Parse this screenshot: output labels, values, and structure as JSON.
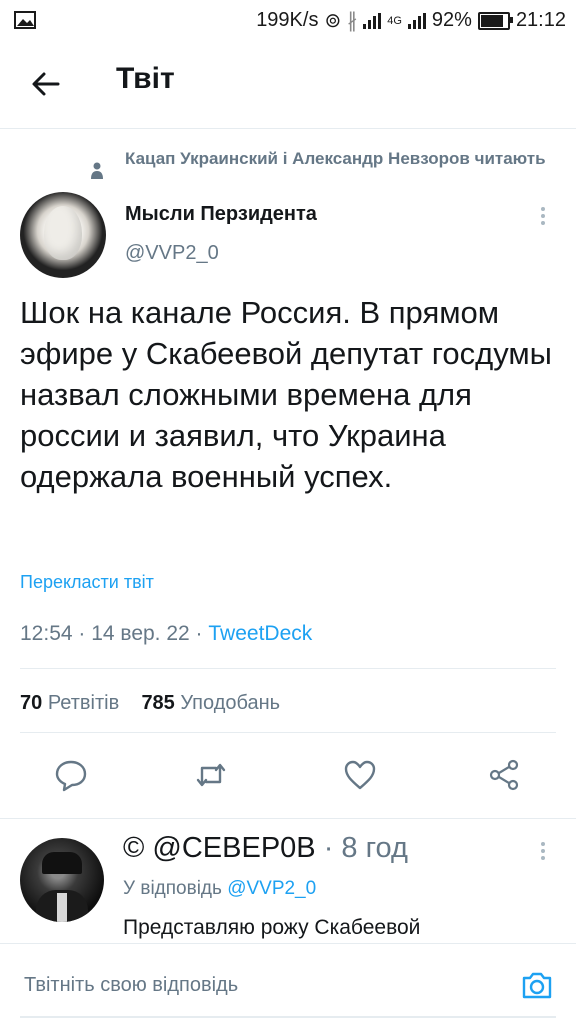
{
  "status_bar": {
    "speed": "199K/s",
    "network": "4G",
    "battery": "92%",
    "battery_level": 0.92,
    "time": "21:12"
  },
  "header": {
    "title": "Твіт"
  },
  "tweet": {
    "social_context": "Кацап Украинский і Александр Невзоров читають",
    "author_name": "Мысли Перзидента",
    "author_handle": "@VVP2_0",
    "text": "Шок на канале Россия. В прямом эфире у Скабеевой депутат госдумы назвал сложными времена для россии и заявил, что Украина одержала военный успех.",
    "translate_label": "Перекласти твіт",
    "timestamp": "12:54 · 14 вер. 22 · ",
    "source": "TweetDeck",
    "retweets_count": "70",
    "retweets_label": "Ретвітів",
    "likes_count": "785",
    "likes_label": "Уподобань"
  },
  "reply": {
    "author": "© @СЕВЕР0В",
    "time": " · 8 год",
    "reply_prefix": "У відповідь ",
    "reply_to": "@VVP2_0",
    "text": "Представляю рожу Скабеевой"
  },
  "compose": {
    "placeholder": "Твітніть свою відповідь"
  },
  "colors": {
    "accent": "#1da1f2",
    "secondary_text": "#657786",
    "divider": "#e6ecf0"
  }
}
